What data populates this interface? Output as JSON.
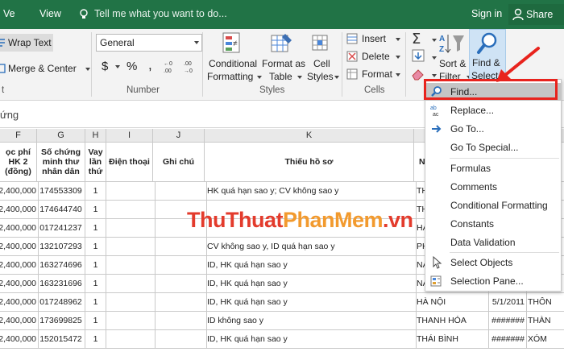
{
  "tabs": {
    "view_left": "Ve",
    "view": "View"
  },
  "tellme": "Tell me what you want to do...",
  "signin": "Sign in",
  "share": "Share",
  "ribbon": {
    "wrap_text": "Wrap Text",
    "merge_center": "Merge & Center",
    "number_format": "General",
    "currency": "$",
    "percent": "%",
    "comma": ",",
    "group_number": "Number",
    "group_styles": "Styles",
    "group_cells": "Cells",
    "conditional_formatting": [
      "Conditional",
      "Formatting"
    ],
    "format_as_table": [
      "Format as",
      "Table"
    ],
    "cell_styles": [
      "Cell",
      "Styles"
    ],
    "insert": "Insert",
    "delete": "Delete",
    "format": "Format",
    "sort_filter": [
      "Sort &",
      "Filter"
    ],
    "find_select": [
      "Find &",
      "Select"
    ]
  },
  "formula_bar": "ứng",
  "columns": [
    "F",
    "G",
    "H",
    "I",
    "J",
    "K",
    "L"
  ],
  "header_row": [
    "ọc phí HK 2 (đồng)",
    "Số chứng minh thư nhân dân",
    "Vay lần thứ",
    "Điện thoại",
    "Ghi chú",
    "Thiếu hồ sơ",
    "N"
  ],
  "rows": [
    [
      "2,400,000",
      "174553309",
      "1",
      "",
      "",
      "HK quá hạn sao y; CV không sao y",
      "TH",
      "",
      ""
    ],
    [
      "2,400,000",
      "174644740",
      "1",
      "",
      "",
      "",
      "TH",
      "",
      ""
    ],
    [
      "2,400,000",
      "017241237",
      "1",
      "",
      "",
      "",
      "HA",
      "",
      ""
    ],
    [
      "2,400,000",
      "132107293",
      "1",
      "",
      "",
      "CV không sao y, ID quá hạn sao y",
      "PH",
      "",
      ""
    ],
    [
      "2,400,000",
      "163274696",
      "1",
      "",
      "",
      "ID, HK quá hạn sao y",
      "NA",
      "",
      ""
    ],
    [
      "2,400,000",
      "163231696",
      "1",
      "",
      "",
      "ID, HK quá hạn sao y",
      "NA",
      "",
      ""
    ],
    [
      "2,400,000",
      "017248962",
      "1",
      "",
      "",
      "ID, HK quá hạn sao y",
      "HÀ NỘI",
      "5/1/2011",
      "THÔN"
    ],
    [
      "2,400,000",
      "173699825",
      "1",
      "",
      "",
      "ID không sao y",
      "THANH HÓA",
      "#######",
      "THÀN"
    ],
    [
      "2,400,000",
      "152015472",
      "1",
      "",
      "",
      "ID, HK quá hạn sao y",
      "THÁI BÌNH",
      "#######",
      "XÓM"
    ]
  ],
  "menu": {
    "items": [
      {
        "label": "Find...",
        "icon": "find-icon"
      },
      {
        "label": "Replace...",
        "icon": "replace-icon"
      },
      {
        "label": "Go To...",
        "icon": "goto-arrow-icon"
      },
      {
        "label": "Go To Special...",
        "icon": ""
      },
      {
        "label": "Formulas",
        "icon": ""
      },
      {
        "label": "Comments",
        "icon": ""
      },
      {
        "label": "Conditional Formatting",
        "icon": ""
      },
      {
        "label": "Constants",
        "icon": ""
      },
      {
        "label": "Data Validation",
        "icon": ""
      },
      {
        "label": "Select Objects",
        "icon": "cursor-icon"
      },
      {
        "label": "Selection Pane...",
        "icon": "selection-pane-icon"
      }
    ]
  },
  "watermark": {
    "part1": "ThuThuat",
    "part2": "PhanMem",
    "part3": ".vn"
  },
  "colors": {
    "brand": "#217346",
    "highlight": "#e8231d"
  }
}
